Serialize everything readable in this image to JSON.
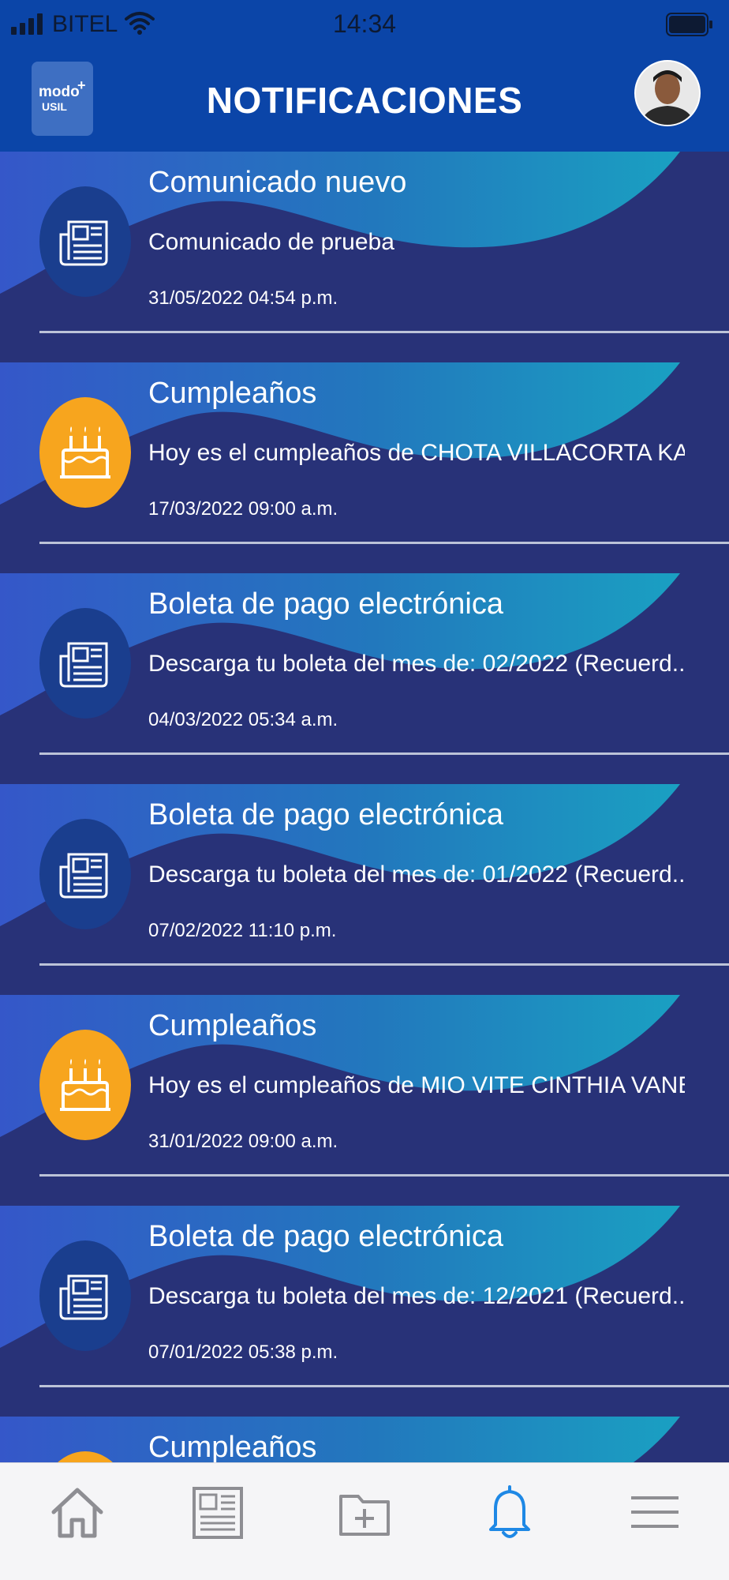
{
  "status_bar": {
    "carrier": "BITEL",
    "time": "14:34"
  },
  "header": {
    "logo_line1": "modo",
    "logo_plus": "+",
    "logo_line2": "USIL",
    "title": "NOTIFICACIONES"
  },
  "notifications": [
    {
      "type": "doc",
      "title": "Comunicado nuevo",
      "body": "Comunicado de prueba",
      "date": "31/05/2022 04:54 p.m."
    },
    {
      "type": "cake",
      "title": "Cumpleaños",
      "body": "Hoy es el cumpleaños de CHOTA VILLACORTA KA...",
      "date": "17/03/2022 09:00 a.m."
    },
    {
      "type": "doc",
      "title": "Boleta de pago electrónica",
      "body": "Descarga tu boleta del mes de:  02/2022 (Recuerd...",
      "date": "04/03/2022 05:34 a.m."
    },
    {
      "type": "doc",
      "title": "Boleta de pago electrónica",
      "body": "Descarga tu boleta del mes de:  01/2022 (Recuerd...",
      "date": "07/02/2022 11:10 p.m."
    },
    {
      "type": "cake",
      "title": "Cumpleaños",
      "body": "Hoy es el cumpleaños de MIO VITE CINTHIA VANE...",
      "date": "31/01/2022 09:00 a.m."
    },
    {
      "type": "doc",
      "title": "Boleta de pago electrónica",
      "body": "Descarga tu boleta del mes de:  12/2021 (Recuerd...",
      "date": "07/01/2022 05:38 p.m."
    },
    {
      "type": "cake",
      "title": "Cumpleaños",
      "body": "",
      "date": ""
    }
  ],
  "tab_bar": {
    "items": [
      {
        "icon": "home-icon",
        "active": false
      },
      {
        "icon": "newspaper-icon",
        "active": false
      },
      {
        "icon": "folder-add-icon",
        "active": false
      },
      {
        "icon": "bell-icon",
        "active": true
      },
      {
        "icon": "menu-icon",
        "active": false
      }
    ]
  },
  "colors": {
    "header_bg": "#0b45a8",
    "card_bg": "#283278",
    "doc_icon_bg": "#1a3e8e",
    "cake_icon_bg": "#f7a51e",
    "tab_active": "#1e88e5",
    "tab_inactive": "#8e8e93"
  }
}
